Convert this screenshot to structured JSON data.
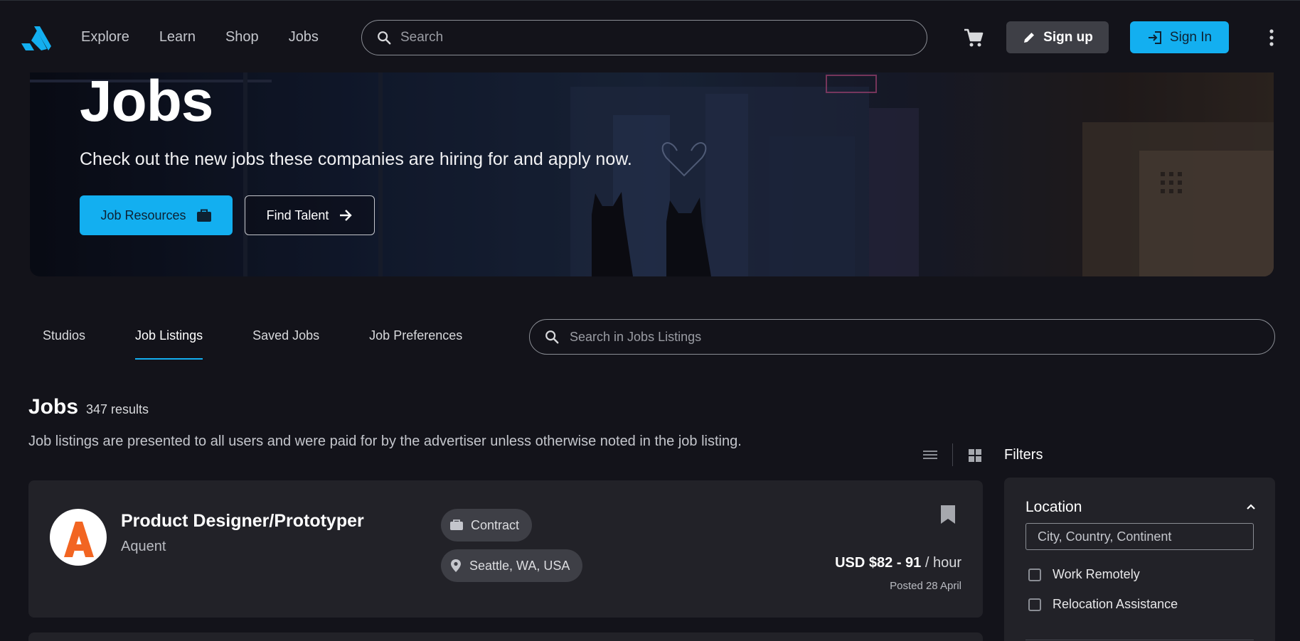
{
  "nav": {
    "links": [
      "Explore",
      "Learn",
      "Shop",
      "Jobs"
    ],
    "search_placeholder": "Search",
    "signup_label": "Sign up",
    "signin_label": "Sign In"
  },
  "hero": {
    "title": "Jobs",
    "subtitle": "Check out the new jobs these companies are hiring for and apply now.",
    "resources_label": "Job Resources",
    "find_talent_label": "Find Talent"
  },
  "tabs": [
    {
      "label": "Studios",
      "active": false
    },
    {
      "label": "Job Listings",
      "active": true
    },
    {
      "label": "Saved Jobs",
      "active": false
    },
    {
      "label": "Job Preferences",
      "active": false
    }
  ],
  "listing_search": {
    "placeholder": "Search in Jobs Listings"
  },
  "results": {
    "heading": "Jobs",
    "count": "347 results",
    "disclaimer": "Job listings are presented to all users and were paid for by the advertiser unless otherwise noted in the job listing."
  },
  "filters": {
    "heading": "Filters",
    "location_label": "Location",
    "location_placeholder": "City, Country, Continent",
    "options": [
      "Work Remotely",
      "Relocation Assistance"
    ]
  },
  "jobs": [
    {
      "title": "Product Designer/Prototyper",
      "company": "Aquent",
      "type": "Contract",
      "location": "Seattle, WA, USA",
      "salary": "USD $82 - 91",
      "salary_unit": "/ hour",
      "posted": "Posted 28 April"
    }
  ],
  "colors": {
    "accent": "#13aff0",
    "background": "#13131a",
    "card": "#222228",
    "company_logo_orange": "#f26522"
  }
}
